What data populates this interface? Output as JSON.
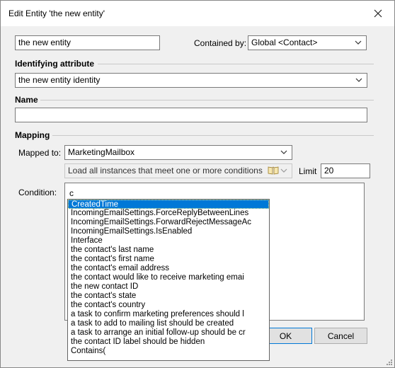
{
  "window": {
    "title": "Edit Entity 'the new entity'"
  },
  "entity": {
    "name_value": "the new entity",
    "contained_by_label": "Contained by:",
    "contained_by_value": "Global <Contact>"
  },
  "identifying": {
    "heading": "Identifying attribute",
    "value": "the new entity identity"
  },
  "name": {
    "heading": "Name",
    "value": ""
  },
  "mapping": {
    "heading": "Mapping",
    "mapped_to_label": "Mapped to:",
    "mapped_to_value": "MarketingMailbox",
    "load_value": "Load all instances that meet one or more conditions",
    "limit_label": "Limit",
    "limit_value": "20",
    "condition_label": "Condition:",
    "condition_value": "c"
  },
  "buttons": {
    "ok": "OK",
    "cancel": "Cancel"
  },
  "autocomplete": {
    "items": [
      "CreatedTime",
      "IncomingEmailSettings.ForceReplyBetweenLines",
      "IncomingEmailSettings.ForwardRejectMessageAc",
      "IncomingEmailSettings.IsEnabled",
      "Interface",
      "the contact's last name",
      "the contact's first name",
      "the contact's email address",
      "the contact would like to receive marketing emai",
      "the new contact ID",
      "the contact's state",
      "the contact's country",
      "a task to confirm marketing preferences should l",
      "a task to add to mailing list should be created",
      "a task to arrange an initial follow-up should be cr",
      "the contact ID label should be hidden",
      "Contains("
    ],
    "selected_index": 0,
    "selection_color": "#0078d7"
  },
  "icons": {
    "close": "close-icon",
    "dropdown": "chevron-down-icon",
    "book": "book-icon",
    "resize": "resize-grip-icon"
  }
}
